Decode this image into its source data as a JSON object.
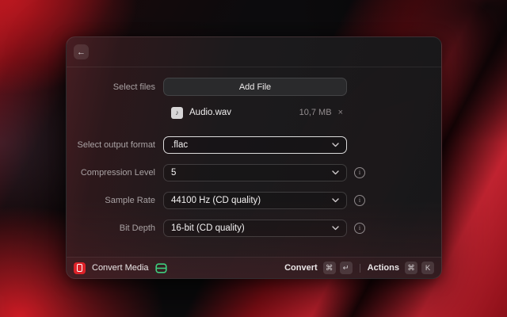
{
  "colors": {
    "accent_red": "#dd2229",
    "green": "#3ecf7e",
    "focus_border": "#ffffff"
  },
  "icons": {
    "back": "←",
    "info": "i",
    "file_glyph": "♪",
    "remove": "×"
  },
  "header": {
    "back_icon": "←"
  },
  "form": {
    "select_files_label": "Select files",
    "add_file_button": "Add File",
    "file": {
      "name": "Audio.wav",
      "size": "10,7 MB",
      "remove_icon": "×"
    },
    "fields": [
      {
        "label": "Select output format",
        "value": ".flac"
      },
      {
        "label": "Compression Level",
        "value": "5"
      },
      {
        "label": "Sample Rate",
        "value": "44100 Hz (CD quality)"
      },
      {
        "label": "Bit Depth",
        "value": "16-bit (CD quality)"
      }
    ]
  },
  "footer": {
    "app_name": "Convert Media",
    "primary_action_label": "Convert",
    "primary_keys": [
      "⌘",
      "↵"
    ],
    "secondary_action_label": "Actions",
    "secondary_keys": [
      "⌘",
      "K"
    ]
  }
}
